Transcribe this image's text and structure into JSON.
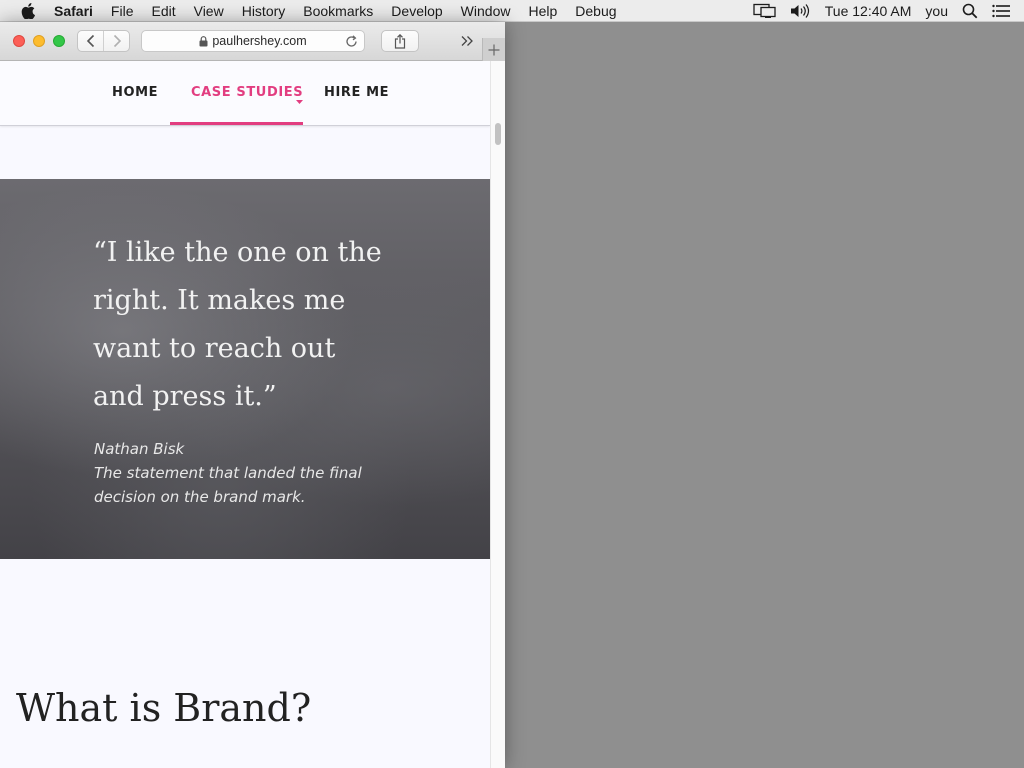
{
  "menubar": {
    "app_name": "Safari",
    "items": [
      "File",
      "Edit",
      "View",
      "History",
      "Bookmarks",
      "Develop",
      "Window",
      "Help",
      "Debug"
    ],
    "clock": "Tue 12:40 AM",
    "user": "you"
  },
  "browser": {
    "url": "paulhershey.com"
  },
  "site": {
    "nav": {
      "home": "HOME",
      "case_studies": "CASE STUDIES",
      "hire_me": "HIRE ME",
      "active": "CASE STUDIES",
      "accent_color": "#e23d80"
    },
    "quote": {
      "text": "“I like the one on the right. It makes me want to reach out and press it.”",
      "author": "Nathan Bisk",
      "caption": "The statement that landed the final decision on the brand mark."
    },
    "section_heading": "What is Brand?"
  }
}
